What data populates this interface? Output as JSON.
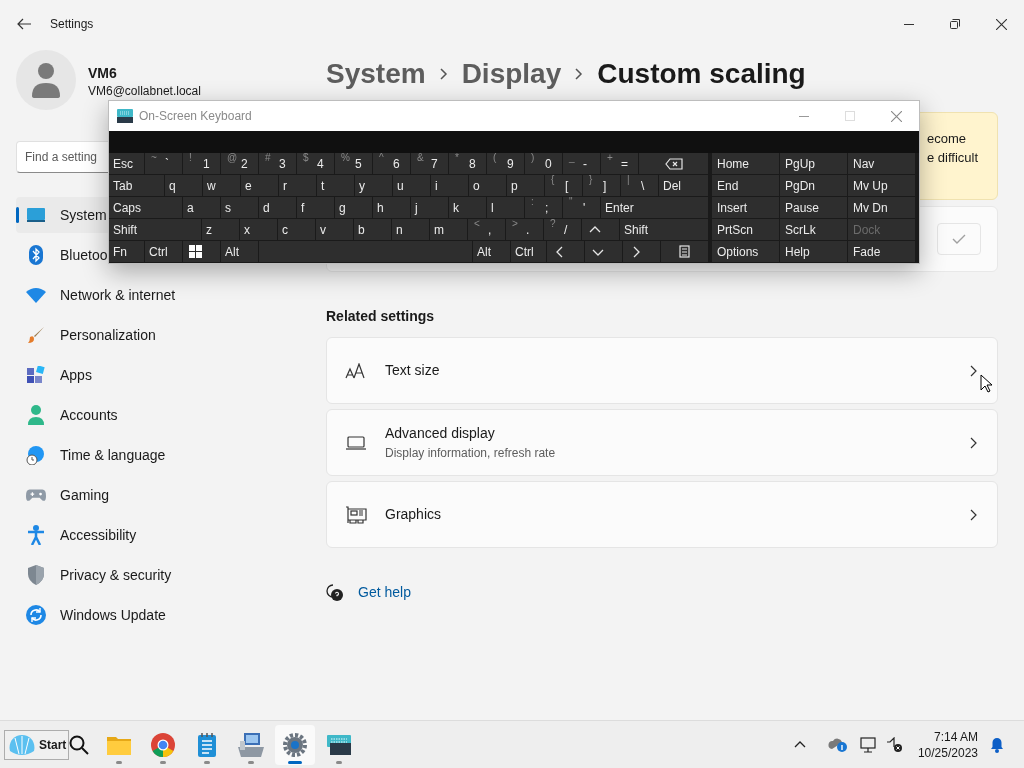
{
  "window": {
    "title": "Settings"
  },
  "user": {
    "name": "VM6",
    "email": "VM6@collabnet.local"
  },
  "search": {
    "placeholder": "Find a setting"
  },
  "sidebar": {
    "items": [
      {
        "label": "System",
        "selected": true
      },
      {
        "label": "Bluetoo",
        "selected": false
      },
      {
        "label": "Network & internet",
        "selected": false
      },
      {
        "label": "Personalization",
        "selected": false
      },
      {
        "label": "Apps",
        "selected": false
      },
      {
        "label": "Accounts",
        "selected": false
      },
      {
        "label": "Time & language",
        "selected": false
      },
      {
        "label": "Gaming",
        "selected": false
      },
      {
        "label": "Accessibility",
        "selected": false
      },
      {
        "label": "Privacy & security",
        "selected": false
      },
      {
        "label": "Windows Update",
        "selected": false
      }
    ]
  },
  "breadcrumb": [
    "System",
    "Display",
    "Custom scaling"
  ],
  "notice": {
    "lines": [
      "ecome",
      "e difficult"
    ]
  },
  "related_settings": {
    "title": "Related settings",
    "items": [
      {
        "title": "Text size"
      },
      {
        "title": "Advanced display",
        "subtitle": "Display information, refresh rate"
      },
      {
        "title": "Graphics"
      }
    ]
  },
  "help": {
    "label": "Get help"
  },
  "keyboard_window": {
    "title": "On-Screen Keyboard",
    "rows": [
      [
        {
          "kind": "text",
          "label": "Esc"
        },
        {
          "kind": "text",
          "shift": "~",
          "label": "`"
        },
        {
          "kind": "text",
          "shift": "!",
          "label": "1"
        },
        {
          "kind": "text",
          "shift": "@",
          "label": "2"
        },
        {
          "kind": "text",
          "shift": "#",
          "label": "3"
        },
        {
          "kind": "text",
          "shift": "$",
          "label": "4"
        },
        {
          "kind": "text",
          "shift": "%",
          "label": "5"
        },
        {
          "kind": "text",
          "shift": "^",
          "label": "6"
        },
        {
          "kind": "text",
          "shift": "&",
          "label": "7"
        },
        {
          "kind": "text",
          "shift": "*",
          "label": "8"
        },
        {
          "kind": "text",
          "shift": "(",
          "label": "9"
        },
        {
          "kind": "text",
          "shift": ")",
          "label": "0"
        },
        {
          "kind": "text",
          "shift": "_",
          "label": "-"
        },
        {
          "kind": "text",
          "shift": "+",
          "label": "="
        },
        {
          "kind": "backspace"
        }
      ],
      [
        {
          "kind": "text",
          "label": "Tab"
        },
        {
          "kind": "text",
          "label": "q"
        },
        {
          "kind": "text",
          "label": "w"
        },
        {
          "kind": "text",
          "label": "e"
        },
        {
          "kind": "text",
          "label": "r"
        },
        {
          "kind": "text",
          "label": "t"
        },
        {
          "kind": "text",
          "label": "y"
        },
        {
          "kind": "text",
          "label": "u"
        },
        {
          "kind": "text",
          "label": "i"
        },
        {
          "kind": "text",
          "label": "o"
        },
        {
          "kind": "text",
          "label": "p"
        },
        {
          "kind": "text",
          "shift": "{",
          "label": "["
        },
        {
          "kind": "text",
          "shift": "}",
          "label": "]"
        },
        {
          "kind": "text",
          "shift": "|",
          "label": "\\"
        },
        {
          "kind": "text",
          "label": "Del"
        }
      ],
      [
        {
          "kind": "text",
          "label": "Caps"
        },
        {
          "kind": "text",
          "label": "a"
        },
        {
          "kind": "text",
          "label": "s"
        },
        {
          "kind": "text",
          "label": "d"
        },
        {
          "kind": "text",
          "label": "f"
        },
        {
          "kind": "text",
          "label": "g"
        },
        {
          "kind": "text",
          "label": "h"
        },
        {
          "kind": "text",
          "label": "j"
        },
        {
          "kind": "text",
          "label": "k"
        },
        {
          "kind": "text",
          "label": "l"
        },
        {
          "kind": "text",
          "shift": ":",
          "label": ";"
        },
        {
          "kind": "text",
          "shift": "\"",
          "label": "'"
        },
        {
          "kind": "text",
          "label": "Enter"
        }
      ],
      [
        {
          "kind": "text",
          "label": "Shift"
        },
        {
          "kind": "text",
          "label": "z"
        },
        {
          "kind": "text",
          "label": "x"
        },
        {
          "kind": "text",
          "label": "c"
        },
        {
          "kind": "text",
          "label": "v"
        },
        {
          "kind": "text",
          "label": "b"
        },
        {
          "kind": "text",
          "label": "n"
        },
        {
          "kind": "text",
          "label": "m"
        },
        {
          "kind": "text",
          "shift": "<",
          "label": ","
        },
        {
          "kind": "text",
          "shift": ">",
          "label": "."
        },
        {
          "kind": "text",
          "shift": "?",
          "label": "/"
        },
        {
          "kind": "up"
        },
        {
          "kind": "text",
          "label": "Shift"
        }
      ],
      [
        {
          "kind": "text",
          "label": "Fn"
        },
        {
          "kind": "text",
          "label": "Ctrl"
        },
        {
          "kind": "windows"
        },
        {
          "kind": "text",
          "label": "Alt"
        },
        {
          "kind": "space"
        },
        {
          "kind": "text",
          "label": "Alt"
        },
        {
          "kind": "text",
          "label": "Ctrl"
        },
        {
          "kind": "left"
        },
        {
          "kind": "down"
        },
        {
          "kind": "right"
        },
        {
          "kind": "menu"
        }
      ]
    ],
    "nav_keys": [
      [
        {
          "label": "Home",
          "disabled": false
        },
        {
          "label": "PgUp",
          "disabled": false
        },
        {
          "label": "Nav",
          "disabled": false
        }
      ],
      [
        {
          "label": "End",
          "disabled": false
        },
        {
          "label": "PgDn",
          "disabled": false
        },
        {
          "label": "Mv Up",
          "disabled": false
        }
      ],
      [
        {
          "label": "Insert",
          "disabled": false
        },
        {
          "label": "Pause",
          "disabled": false
        },
        {
          "label": "Mv Dn",
          "disabled": false
        }
      ],
      [
        {
          "label": "PrtScn",
          "disabled": false
        },
        {
          "label": "ScrLk",
          "disabled": false
        },
        {
          "label": "Dock",
          "disabled": true
        }
      ],
      [
        {
          "label": "Options",
          "disabled": false
        },
        {
          "label": "Help",
          "disabled": false
        },
        {
          "label": "Fade",
          "disabled": false
        }
      ]
    ]
  },
  "taskbar": {
    "start": "Start",
    "apps": [
      {
        "selected": false
      },
      {
        "selected": false
      },
      {
        "selected": false
      },
      {
        "selected": false
      },
      {
        "selected": true
      },
      {
        "selected": false
      }
    ],
    "time": "7:14 AM",
    "date": "10/25/2023"
  }
}
